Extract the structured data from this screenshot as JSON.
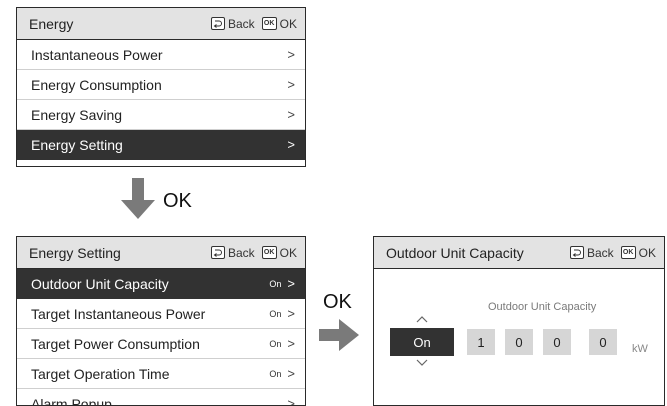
{
  "common": {
    "back": "Back",
    "ok_icon": "OK",
    "ok": "OK"
  },
  "panel1": {
    "title": "Energy",
    "items": [
      {
        "label": "Instantaneous Power",
        "chevron": ">"
      },
      {
        "label": "Energy Consumption",
        "chevron": ">"
      },
      {
        "label": "Energy Saving",
        "chevron": ">"
      },
      {
        "label": "Energy Setting",
        "chevron": ">"
      }
    ],
    "selected_index": 3
  },
  "arrow_down_label": "OK",
  "panel2": {
    "title": "Energy Setting",
    "items": [
      {
        "label": "Outdoor Unit Capacity",
        "value": "On",
        "chevron": ">"
      },
      {
        "label": "Target Instantaneous Power",
        "value": "On",
        "chevron": ">"
      },
      {
        "label": "Target Power Consumption",
        "value": "On",
        "chevron": ">"
      },
      {
        "label": "Target Operation Time",
        "value": "On",
        "chevron": ">"
      },
      {
        "label": "Alarm Popup",
        "value": "",
        "chevron": ">"
      }
    ],
    "selected_index": 0
  },
  "arrow_right_label": "OK",
  "panel3": {
    "title": "Outdoor Unit Capacity",
    "caption": "Outdoor Unit Capacity",
    "toggle_value": "On",
    "digits": [
      "1",
      "0",
      "0",
      "0"
    ],
    "unit": "kW"
  },
  "colors": {
    "selected_bg": "#323232",
    "header_bg": "#e3e3e3",
    "digit_bg": "#d6d6d6"
  },
  "icons": [
    "back-icon",
    "ok-icon",
    "chevron-right-icon",
    "arrow-down-icon",
    "arrow-right-icon",
    "chevron-up-icon",
    "chevron-down-icon"
  ]
}
